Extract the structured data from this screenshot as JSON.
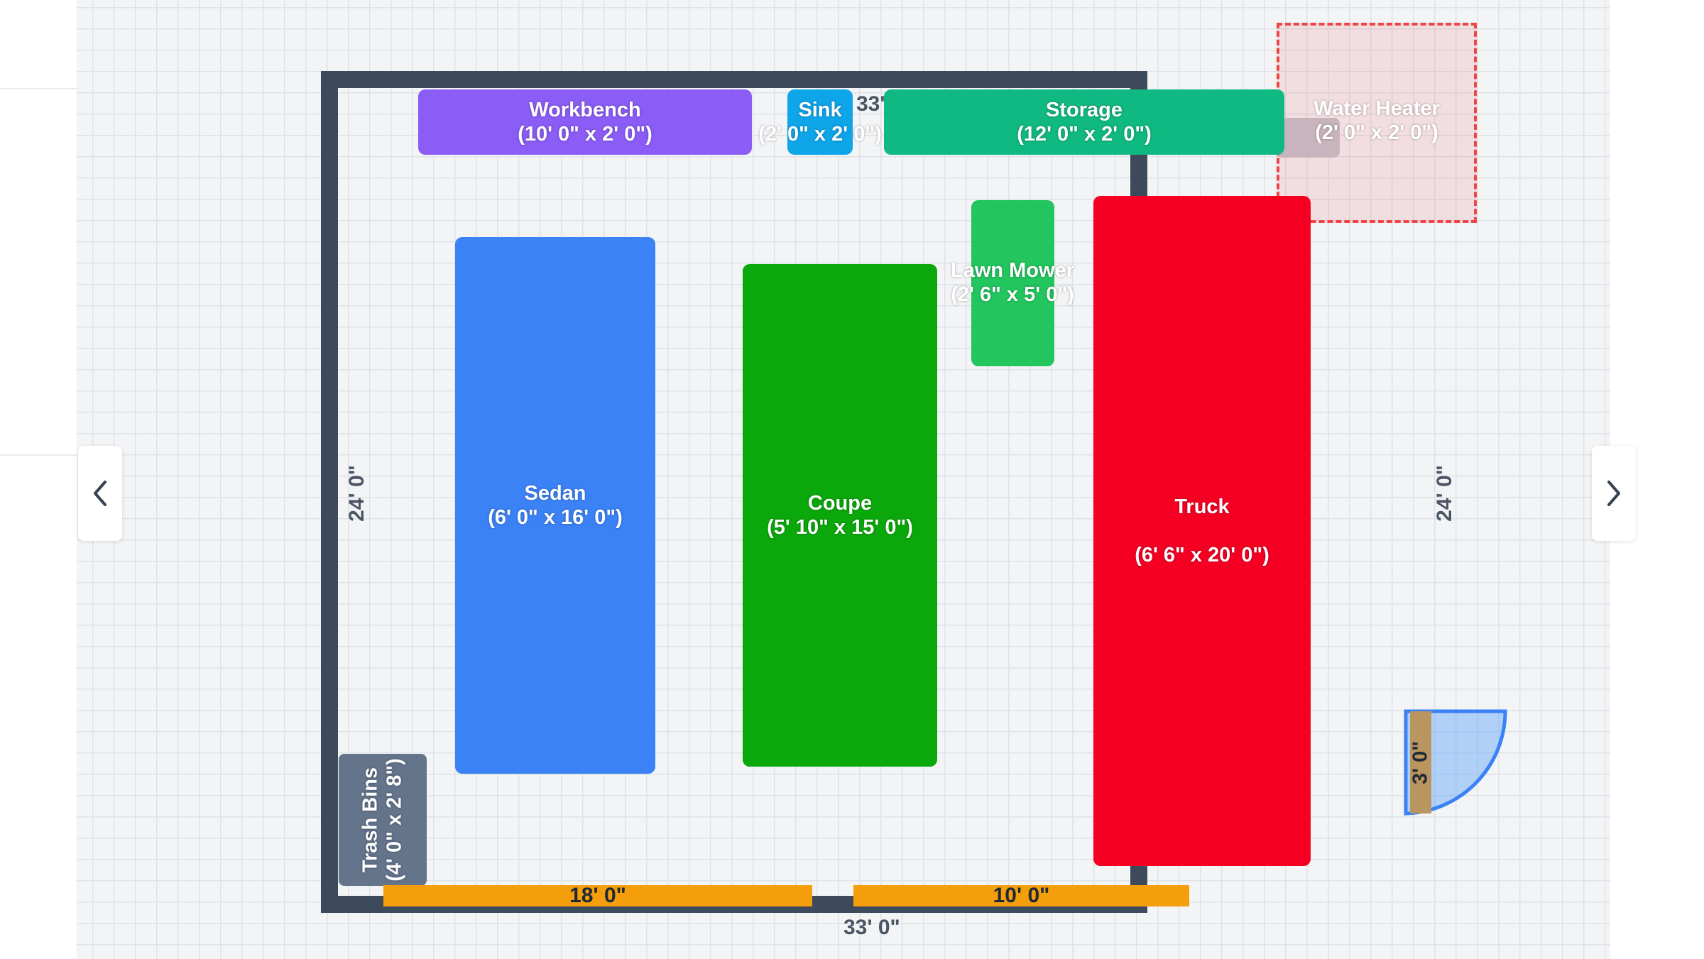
{
  "floorplan": {
    "dimensions": {
      "top_width": "33' 0\"",
      "bottom_width": "33' 0\"",
      "left_depth": "24' 0\"",
      "right_depth": "24' 0\""
    },
    "openings": [
      {
        "label": "18' 0\""
      },
      {
        "label": "10' 0\""
      }
    ],
    "door": {
      "label": "3' 0\""
    },
    "items": {
      "workbench": {
        "name": "Workbench",
        "size": "(10' 0\" x 2' 0\")",
        "color": "#8b5cf6"
      },
      "sink": {
        "name": "Sink",
        "size": "(2' 0\" x 2' 0\")",
        "color": "#0ea5e9"
      },
      "storage": {
        "name": "Storage",
        "size": "(12' 0\" x 2' 0\")",
        "color": "#10b981"
      },
      "water_heater": {
        "name": "Water Heater",
        "size": "(2' 0\" x 2' 0\")",
        "color": "#c4c4cf"
      },
      "lawn_mower": {
        "name": "Lawn Mower",
        "size": "(2' 6\" x 5' 0\")",
        "color": "#22c55e"
      },
      "sedan": {
        "name": "Sedan",
        "size": "(6' 0\" x 16' 0\")",
        "color": "#3b82f6"
      },
      "coupe": {
        "name": "Coupe",
        "size": "(5' 10\" x 15' 0\")",
        "color": "#0aa80a"
      },
      "truck": {
        "name": "Truck",
        "size": "(6' 6\" x 20' 0\")",
        "color": "#f50023"
      },
      "trash_bins": {
        "name": "Trash Bins",
        "size": "(4' 0\" x 2' 8\")",
        "color": "#64748b"
      }
    }
  },
  "nav": {
    "prev_icon": "chevron-left-icon",
    "next_icon": "chevron-right-icon"
  }
}
